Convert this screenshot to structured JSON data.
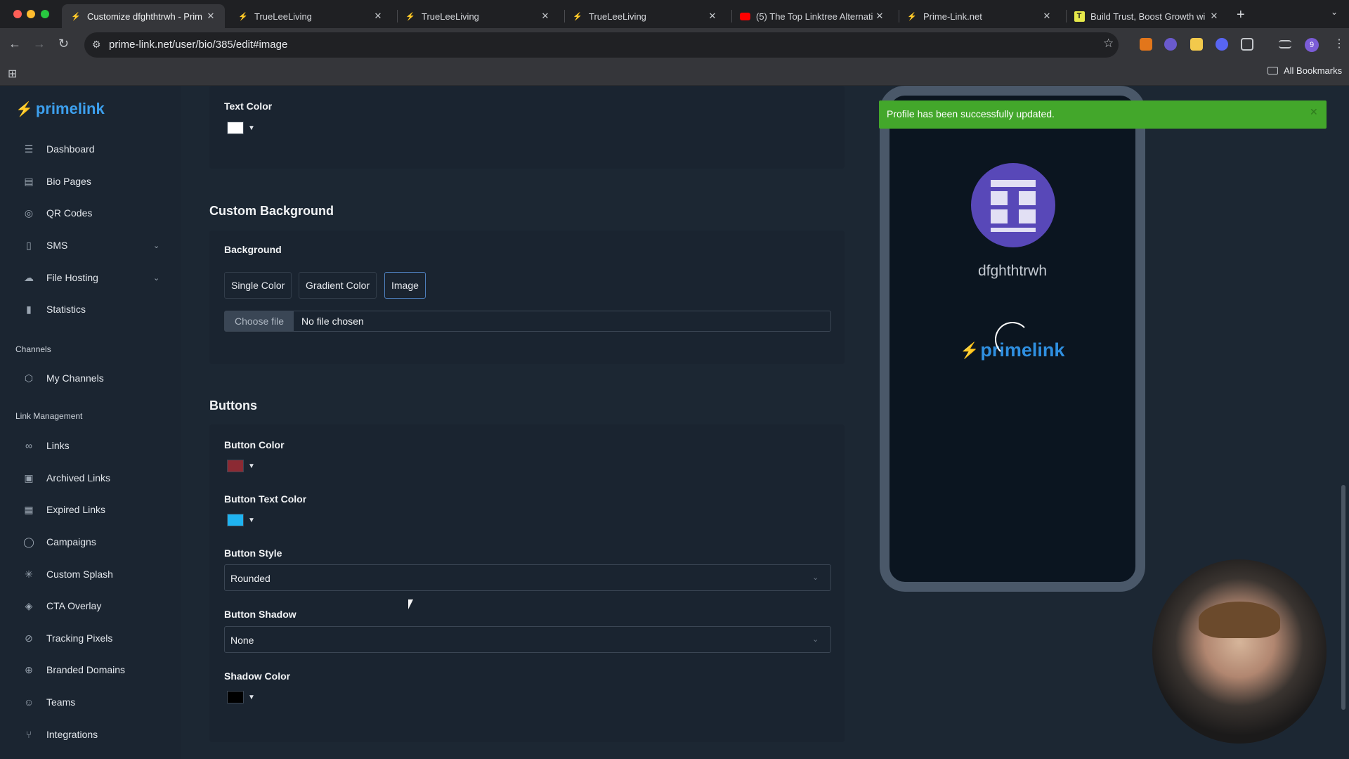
{
  "browser": {
    "tabs": [
      {
        "title": "Customize dfghthtrwh - Prim",
        "active": true,
        "icon": "primelink-favicon"
      },
      {
        "title": "TrueLeeLiving",
        "active": false,
        "icon": "primelink-favicon"
      },
      {
        "title": "TrueLeeLiving",
        "active": false,
        "icon": "primelink-favicon"
      },
      {
        "title": "TrueLeeLiving",
        "active": false,
        "icon": "primelink-favicon"
      },
      {
        "title": "(5) The Top Linktree Alternati",
        "active": false,
        "icon": "youtube-favicon"
      },
      {
        "title": "Prime-Link.net",
        "active": false,
        "icon": "primelink-favicon"
      },
      {
        "title": "Build Trust, Boost Growth wi",
        "active": false,
        "icon": "t-favicon"
      }
    ],
    "url": "prime-link.net/user/bio/385/edit#image",
    "bookmarks_label": "All Bookmarks"
  },
  "sidebar": {
    "logo": "primelink",
    "items": [
      {
        "label": "Dashboard",
        "icon": "sliders-icon"
      },
      {
        "label": "Bio Pages",
        "icon": "layout-icon"
      },
      {
        "label": "QR Codes",
        "icon": "qr-icon"
      },
      {
        "label": "SMS",
        "icon": "phone-icon",
        "expandable": true
      },
      {
        "label": "File Hosting",
        "icon": "cloud-upload-icon",
        "expandable": true
      },
      {
        "label": "Statistics",
        "icon": "bar-chart-icon"
      }
    ],
    "channels_heading": "Channels",
    "channels": [
      {
        "label": "My Channels",
        "icon": "box-icon"
      }
    ],
    "link_management_heading": "Link Management",
    "link_management": [
      {
        "label": "Links",
        "icon": "link-icon"
      },
      {
        "label": "Archived Links",
        "icon": "archive-icon"
      },
      {
        "label": "Expired Links",
        "icon": "calendar-icon"
      },
      {
        "label": "Campaigns",
        "icon": "target-icon"
      },
      {
        "label": "Custom Splash",
        "icon": "loader-icon"
      },
      {
        "label": "CTA Overlay",
        "icon": "layers-icon"
      },
      {
        "label": "Tracking Pixels",
        "icon": "crosshair-icon"
      },
      {
        "label": "Branded Domains",
        "icon": "globe-icon"
      },
      {
        "label": "Teams",
        "icon": "users-icon"
      },
      {
        "label": "Integrations",
        "icon": "git-branch-icon"
      }
    ]
  },
  "editor": {
    "text_color": {
      "label": "Text Color",
      "value": "#ffffff"
    },
    "custom_background": {
      "title": "Custom Background",
      "background_label": "Background",
      "options": [
        "Single Color",
        "Gradient Color",
        "Image"
      ],
      "selected": "Image",
      "file_button": "Choose file",
      "file_status": "No file chosen"
    },
    "buttons": {
      "title": "Buttons",
      "button_color": {
        "label": "Button Color",
        "value": "#8b2a33"
      },
      "button_text_color": {
        "label": "Button Text Color",
        "value": "#1fb3f0"
      },
      "button_style": {
        "label": "Button Style",
        "value": "Rounded"
      },
      "button_shadow": {
        "label": "Button Shadow",
        "value": "None"
      },
      "shadow_color": {
        "label": "Shadow Color",
        "value": "#000000"
      }
    }
  },
  "preview": {
    "username": "dfghthtrwh",
    "footer_logo": "primelink"
  },
  "toast": {
    "message": "Profile has been successfully updated.",
    "color": "#43a72b"
  }
}
